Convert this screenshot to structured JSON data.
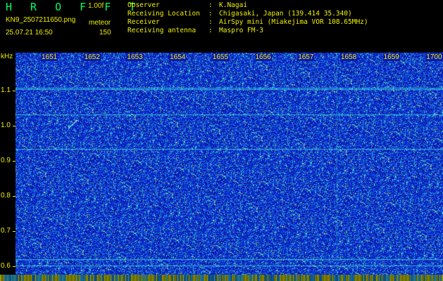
{
  "header": {
    "app_title": "H R O F F T",
    "version": "1.00f",
    "file_name": "KN9_2507211650.png",
    "mode": "meteor",
    "timestamp": "25.07.21 16:50",
    "count": "150"
  },
  "info": [
    {
      "label": "Observer",
      "sep": ":",
      "value": "K.Nagai"
    },
    {
      "label": "Receiving Location",
      "sep": ":",
      "value": "Chigasaki, Japan (139.414 35.340)"
    },
    {
      "label": "Receiver",
      "sep": ":",
      "value": "AirSpy mini (Miakejima VOR 108.65MHz)"
    },
    {
      "label": "Receiving antenna",
      "sep": ":",
      "value": "Maspro FM-3"
    }
  ],
  "y_axis": {
    "unit": "kHz",
    "ticks": [
      {
        "label": "1.1",
        "value": 1.1
      },
      {
        "label": "1.0",
        "value": 1.0
      },
      {
        "label": "0.9",
        "value": 0.9
      },
      {
        "label": "0.8",
        "value": 0.8
      },
      {
        "label": "0.7",
        "value": 0.7
      },
      {
        "label": "0.6",
        "value": 0.6
      }
    ]
  },
  "time_axis": {
    "labels": [
      "1651",
      "1652",
      "1653",
      "1654",
      "1655",
      "1656",
      "1657",
      "1658",
      "1659",
      "1700"
    ]
  },
  "colors": {
    "background": "#000000",
    "text": "#f0f000",
    "title": "#00ff66",
    "noise_base": "#0a1aa8"
  }
}
